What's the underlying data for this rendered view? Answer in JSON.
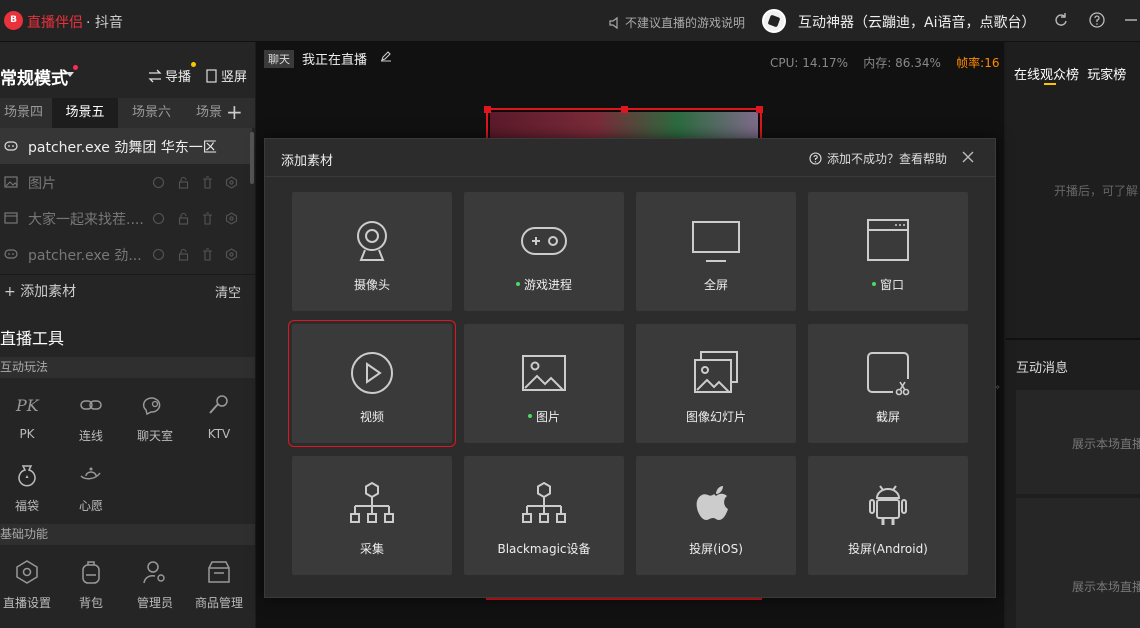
{
  "app": {
    "logo_text": "B",
    "name": "直播伴侣",
    "platform": "· 抖音",
    "notice": "不建议直播的游戏说明",
    "user_name": "互动神器（云蹦迪，Ai语音，点歌台）"
  },
  "left": {
    "mode_title": "常规模式",
    "guide_label": "导播",
    "portrait_label": "竖屏",
    "scene_tabs": [
      "场景四",
      "场景五",
      "场景六",
      "场景"
    ],
    "sources": [
      {
        "label": "patcher.exe 劲舞团 华东一区",
        "icon": "gamepad-icon"
      },
      {
        "label": "图片",
        "icon": "image-icon"
      },
      {
        "label": "大家一起来找茬....",
        "icon": "window-icon"
      },
      {
        "label": "patcher.exe 劲...",
        "icon": "gamepad-icon"
      }
    ],
    "add_source": "添加素材",
    "clear": "清空",
    "tools_title": "直播工具",
    "section_interactive": "互动玩法",
    "interactive_tools": [
      "PK",
      "连线",
      "聊天室",
      "KTV",
      "福袋",
      "心愿"
    ],
    "section_basic": "基础功能",
    "basic_tools": [
      "直播设置",
      "背包",
      "管理员",
      "商品管理"
    ]
  },
  "stage": {
    "chat_tag": "聊天",
    "live_title": "我正在直播",
    "cpu": "CPU: 14.17%",
    "mem": "内存: 86.34%",
    "fps": "帧率:16"
  },
  "right": {
    "tab_online": "在线观众榜",
    "tab_players": "玩家榜",
    "hint_online": "开播后，可了解",
    "interact_title": "互动消息",
    "interact_hint": "展示本场直播"
  },
  "modal": {
    "title": "添加素材",
    "help": "添加不成功？查看帮助",
    "tiles": [
      {
        "label": "摄像头",
        "icon": "camera-icon",
        "dot": false
      },
      {
        "label": "游戏进程",
        "icon": "gamepad-icon",
        "dot": true
      },
      {
        "label": "全屏",
        "icon": "monitor-icon",
        "dot": false
      },
      {
        "label": "窗口",
        "icon": "window-icon",
        "dot": true
      },
      {
        "label": "视频",
        "icon": "play-icon",
        "dot": false
      },
      {
        "label": "图片",
        "icon": "image-icon",
        "dot": true
      },
      {
        "label": "图像幻灯片",
        "icon": "slideshow-icon",
        "dot": false
      },
      {
        "label": "截屏",
        "icon": "screenshot-icon",
        "dot": false
      },
      {
        "label": "采集",
        "icon": "capture-icon",
        "dot": false
      },
      {
        "label": "Blackmagic设备",
        "icon": "blackmagic-icon",
        "dot": false
      },
      {
        "label": "投屏(iOS)",
        "icon": "apple-icon",
        "dot": false
      },
      {
        "label": "投屏(Android)",
        "icon": "android-icon",
        "dot": false
      }
    ],
    "selected": "视频"
  },
  "colors": {
    "accent_red": "#e0161f",
    "brand_red": "#e8323c",
    "fps_orange": "#ff8a00",
    "dot_green": "#4cd964",
    "tab_underline": "#f7c600"
  }
}
